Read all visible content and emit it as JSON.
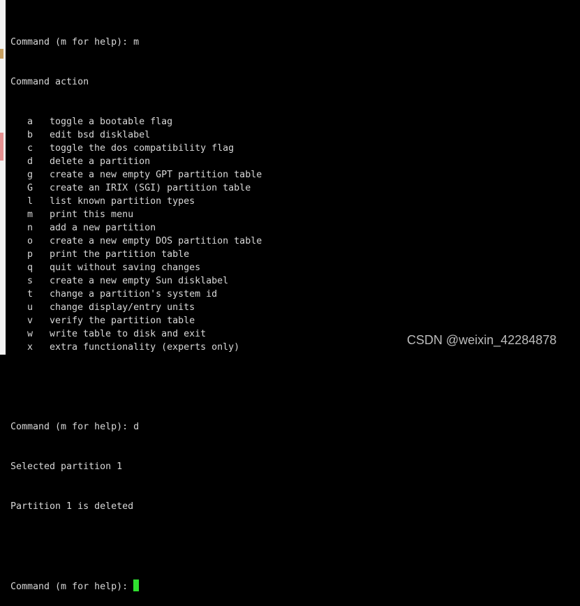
{
  "terminal": {
    "prompt1": "Command (m for help): m",
    "menu_header": "Command action",
    "menu": [
      {
        "key": "a",
        "desc": "toggle a bootable flag"
      },
      {
        "key": "b",
        "desc": "edit bsd disklabel"
      },
      {
        "key": "c",
        "desc": "toggle the dos compatibility flag"
      },
      {
        "key": "d",
        "desc": "delete a partition"
      },
      {
        "key": "g",
        "desc": "create a new empty GPT partition table"
      },
      {
        "key": "G",
        "desc": "create an IRIX (SGI) partition table"
      },
      {
        "key": "l",
        "desc": "list known partition types"
      },
      {
        "key": "m",
        "desc": "print this menu"
      },
      {
        "key": "n",
        "desc": "add a new partition"
      },
      {
        "key": "o",
        "desc": "create a new empty DOS partition table"
      },
      {
        "key": "p",
        "desc": "print the partition table"
      },
      {
        "key": "q",
        "desc": "quit without saving changes"
      },
      {
        "key": "s",
        "desc": "create a new empty Sun disklabel"
      },
      {
        "key": "t",
        "desc": "change a partition's system id"
      },
      {
        "key": "u",
        "desc": "change display/entry units"
      },
      {
        "key": "v",
        "desc": "verify the partition table"
      },
      {
        "key": "w",
        "desc": "write table to disk and exit"
      },
      {
        "key": "x",
        "desc": "extra functionality (experts only)"
      }
    ],
    "prompt2": "Command (m for help): d",
    "out1": "Selected partition 1",
    "out2": "Partition 1 is deleted",
    "prompt3": "Command (m for help): ",
    "cursor_color": "#2fe02f"
  },
  "watermark": "CSDN @weixin_42284878"
}
